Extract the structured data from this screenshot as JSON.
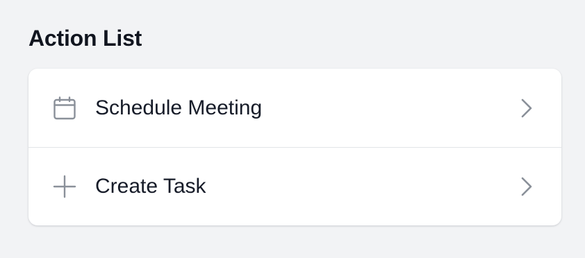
{
  "page": {
    "title": "Action List"
  },
  "actions": [
    {
      "label": "Schedule Meeting",
      "icon": "calendar-icon"
    },
    {
      "label": "Create Task",
      "icon": "plus-icon"
    }
  ],
  "colors": {
    "background": "#f2f3f5",
    "card": "#ffffff",
    "text": "#161b28",
    "icon": "#8a9099",
    "divider": "#e2e4e8"
  }
}
